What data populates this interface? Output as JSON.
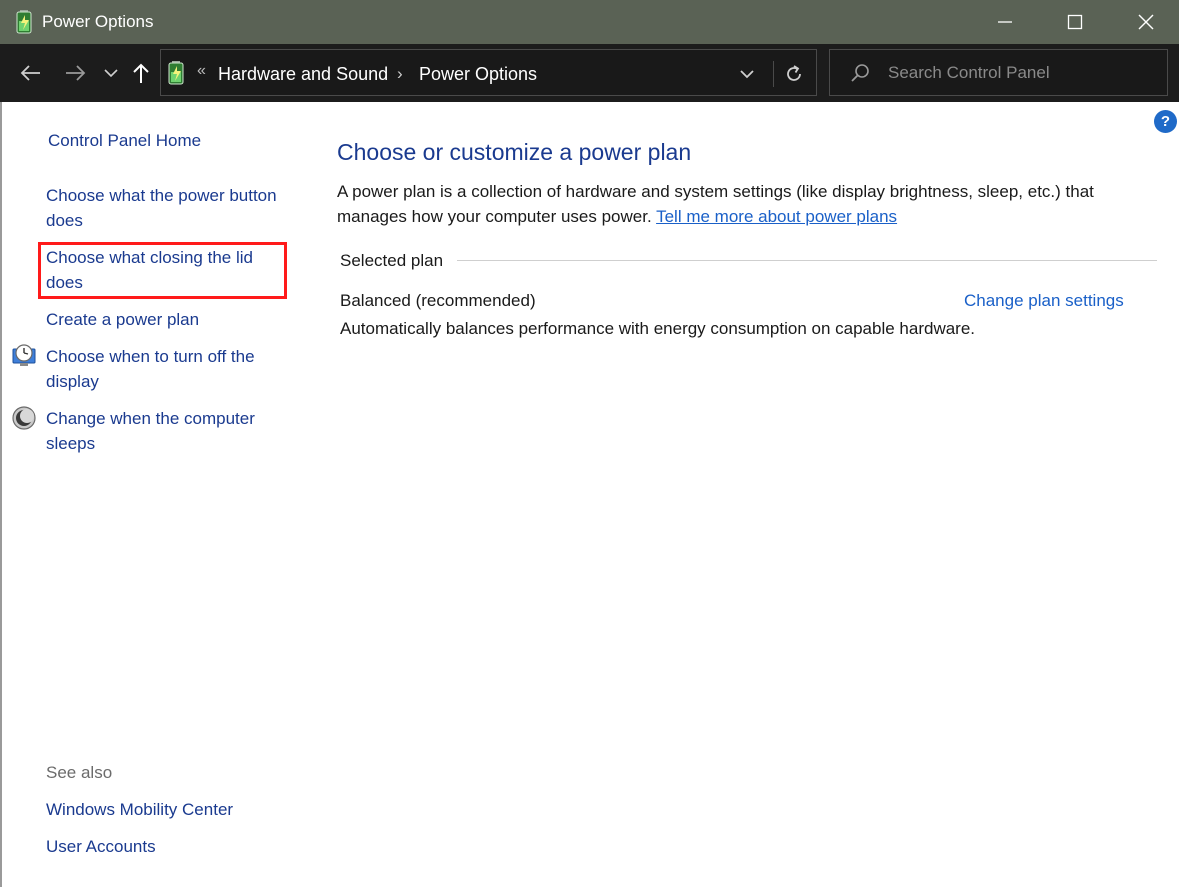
{
  "window": {
    "title": "Power Options"
  },
  "address": {
    "breadcrumbs": [
      "Hardware and Sound",
      "Power Options"
    ],
    "separator": "«"
  },
  "search": {
    "placeholder": "Search Control Panel"
  },
  "sidebar": {
    "home": "Control Panel Home",
    "items": [
      {
        "label": "Choose what the power button does"
      },
      {
        "label": "Choose what closing the lid does"
      },
      {
        "label": "Create a power plan"
      },
      {
        "label": "Choose when to turn off the display"
      },
      {
        "label": "Change when the computer sleeps"
      }
    ],
    "see_also_heading": "See also",
    "see_also": [
      {
        "label": "Windows Mobility Center"
      },
      {
        "label": "User Accounts"
      }
    ]
  },
  "main": {
    "title": "Choose or customize a power plan",
    "description": "A power plan is a collection of hardware and system settings (like display brightness, sleep, etc.) that manages how your computer uses power.",
    "learn_more": "Tell me more about power plans",
    "selected_plan_heading": "Selected plan",
    "plan": {
      "name": "Balanced (recommended)",
      "change_link": "Change plan settings",
      "description": "Automatically balances performance with energy consumption on capable hardware."
    }
  },
  "help": {
    "symbol": "?"
  },
  "colors": {
    "titlebar": "#5a6255",
    "link": "#1a3a8f",
    "highlight": "#ff1a1a"
  }
}
